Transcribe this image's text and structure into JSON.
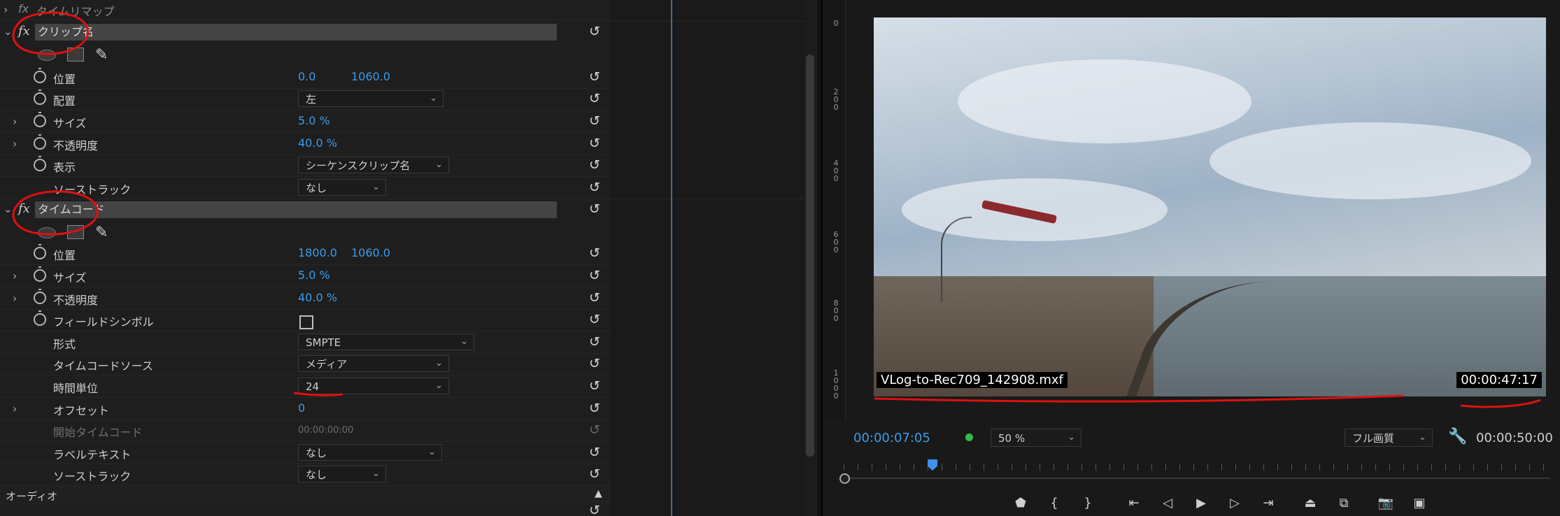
{
  "effect_controls": {
    "top_item": {
      "fx": "fx",
      "label": "タイムリマップ"
    },
    "clip_name_effect": {
      "fx": "fx",
      "title": "クリップ名",
      "position": {
        "label": "位置",
        "x": "0.0",
        "y": "1060.0"
      },
      "alignment": {
        "label": "配置",
        "value": "左"
      },
      "size": {
        "label": "サイズ",
        "value": "5.0 %"
      },
      "opacity": {
        "label": "不透明度",
        "value": "40.0 %"
      },
      "display": {
        "label": "表示",
        "value": "シーケンスクリップ名"
      },
      "source_track": {
        "label": "ソーストラック",
        "value": "なし"
      }
    },
    "timecode_effect": {
      "fx": "fx",
      "title": "タイムコード",
      "position": {
        "label": "位置",
        "x": "1800.0",
        "y": "1060.0"
      },
      "size": {
        "label": "サイズ",
        "value": "5.0 %"
      },
      "opacity": {
        "label": "不透明度",
        "value": "40.0 %"
      },
      "field_symbol": {
        "label": "フィールドシンボル"
      },
      "format": {
        "label": "形式",
        "value": "SMPTE"
      },
      "tc_source": {
        "label": "タイムコードソース",
        "value": "メディア"
      },
      "time_unit": {
        "label": "時間単位",
        "value": "24"
      },
      "offset": {
        "label": "オフセット",
        "value": "0"
      },
      "start_tc": {
        "label": "開始タイムコード",
        "value": "00:00:00:00"
      },
      "label_text": {
        "label": "ラベルテキスト",
        "value": "なし"
      },
      "source_track": {
        "label": "ソーストラック",
        "value": "なし"
      }
    },
    "audio": {
      "label": "オーディオ"
    }
  },
  "program_monitor": {
    "ruler_ticks": [
      "0",
      "2\n0\n0",
      "4\n0\n0",
      "6\n0\n0",
      "8\n0\n0",
      "1\n0\n0\n0"
    ],
    "overlay_clip_name": "VLog-to-Rec709_142908.mxf",
    "overlay_timecode": "00:00:47:17",
    "current_timecode": "00:00:07:05",
    "zoom": "50 %",
    "quality": "フル画質",
    "duration": "00:00:50:00"
  },
  "colors": {
    "accent_blue": "#3d9be9",
    "green_dot": "#2fbd48",
    "annotation_red": "#e01010"
  }
}
